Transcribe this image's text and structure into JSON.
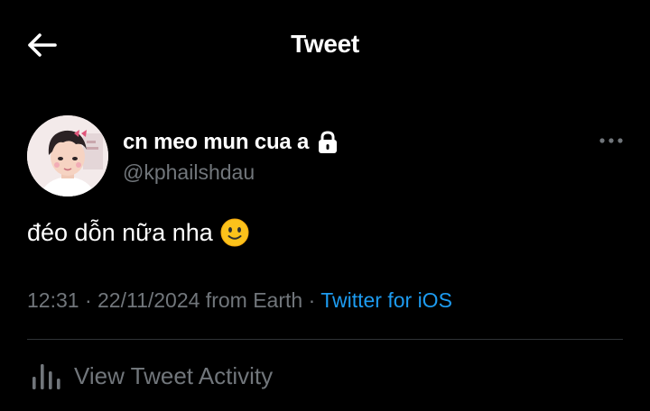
{
  "header": {
    "title": "Tweet",
    "back_icon": "arrow-left-icon"
  },
  "author": {
    "display_name": "cn meo mun cua a",
    "handle": "@kphailshdau",
    "protected_icon": "lock-icon",
    "avatar": "profile-photo",
    "more_icon": "more-horizontal-icon"
  },
  "tweet": {
    "text": "đéo dỗn nữa nha",
    "emoji_icon": "slightly-smiling-face-icon"
  },
  "meta": {
    "time": "12:31",
    "separator1": " · ",
    "date": "22/11/2024",
    "location": " from Earth",
    "separator2": " · ",
    "source": "Twitter for iOS"
  },
  "activity": {
    "label": "View Tweet Activity",
    "icon": "bar-chart-icon"
  },
  "colors": {
    "background": "#000000",
    "primary_text": "#ffffff",
    "secondary_text": "#71767b",
    "link": "#1d9bf0",
    "divider": "#2f3336"
  }
}
